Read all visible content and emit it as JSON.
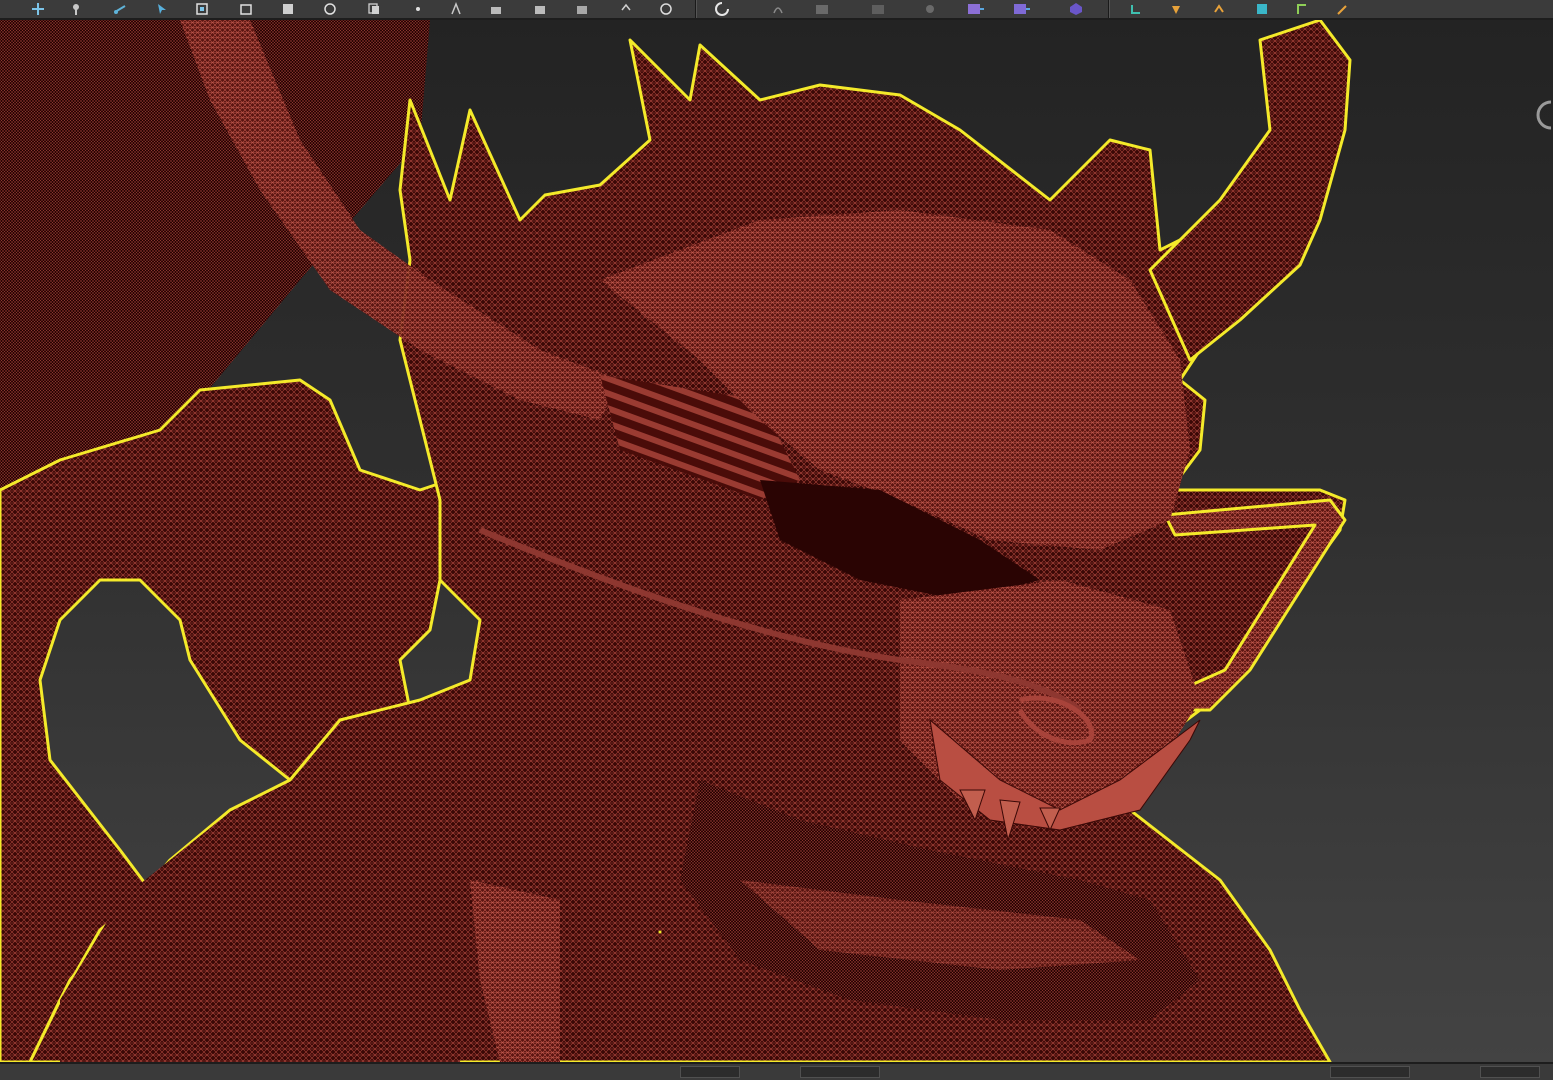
{
  "app": {
    "title": ""
  },
  "toolbar": {
    "buttons": [
      {
        "icon": "move-icon"
      },
      {
        "icon": "pin-icon"
      },
      {
        "icon": "link-icon"
      },
      {
        "icon": "select-object-icon"
      },
      {
        "icon": "select-region-icon"
      },
      {
        "icon": "window-crossing-icon"
      },
      {
        "icon": "rotate-icon"
      },
      {
        "icon": "scale-icon"
      },
      {
        "icon": "copy-icon"
      },
      {
        "icon": "pivot-icon"
      },
      {
        "icon": "snap-toggle-icon"
      },
      {
        "icon": "angle-snap-icon"
      },
      {
        "icon": "percent-snap-icon"
      },
      {
        "icon": "spinner-snap-icon"
      },
      {
        "icon": "undo-icon"
      },
      {
        "icon": "redo-icon"
      },
      {
        "icon": "mirror-icon"
      },
      {
        "icon": "align-icon"
      },
      {
        "icon": "layer-manager-icon"
      },
      {
        "icon": "scene-explorer-icon"
      },
      {
        "icon": "curve-editor-icon"
      },
      {
        "icon": "schematic-view-icon"
      },
      {
        "icon": "material-editor-icon"
      },
      {
        "icon": "render-setup-icon"
      },
      {
        "icon": "render-frame-icon"
      },
      {
        "icon": "render-icon"
      },
      {
        "icon": "quick-align-icon"
      }
    ]
  },
  "viewport": {
    "name": "perspective-viewport",
    "selection_outline_color": "#f4ea2a",
    "mesh_color": "#a8433a",
    "mesh_shadow_color": "#3a0806",
    "background_top": "#232323",
    "background_bottom": "#434343"
  },
  "statusbar": {
    "fields": [
      "",
      "",
      "",
      ""
    ]
  }
}
